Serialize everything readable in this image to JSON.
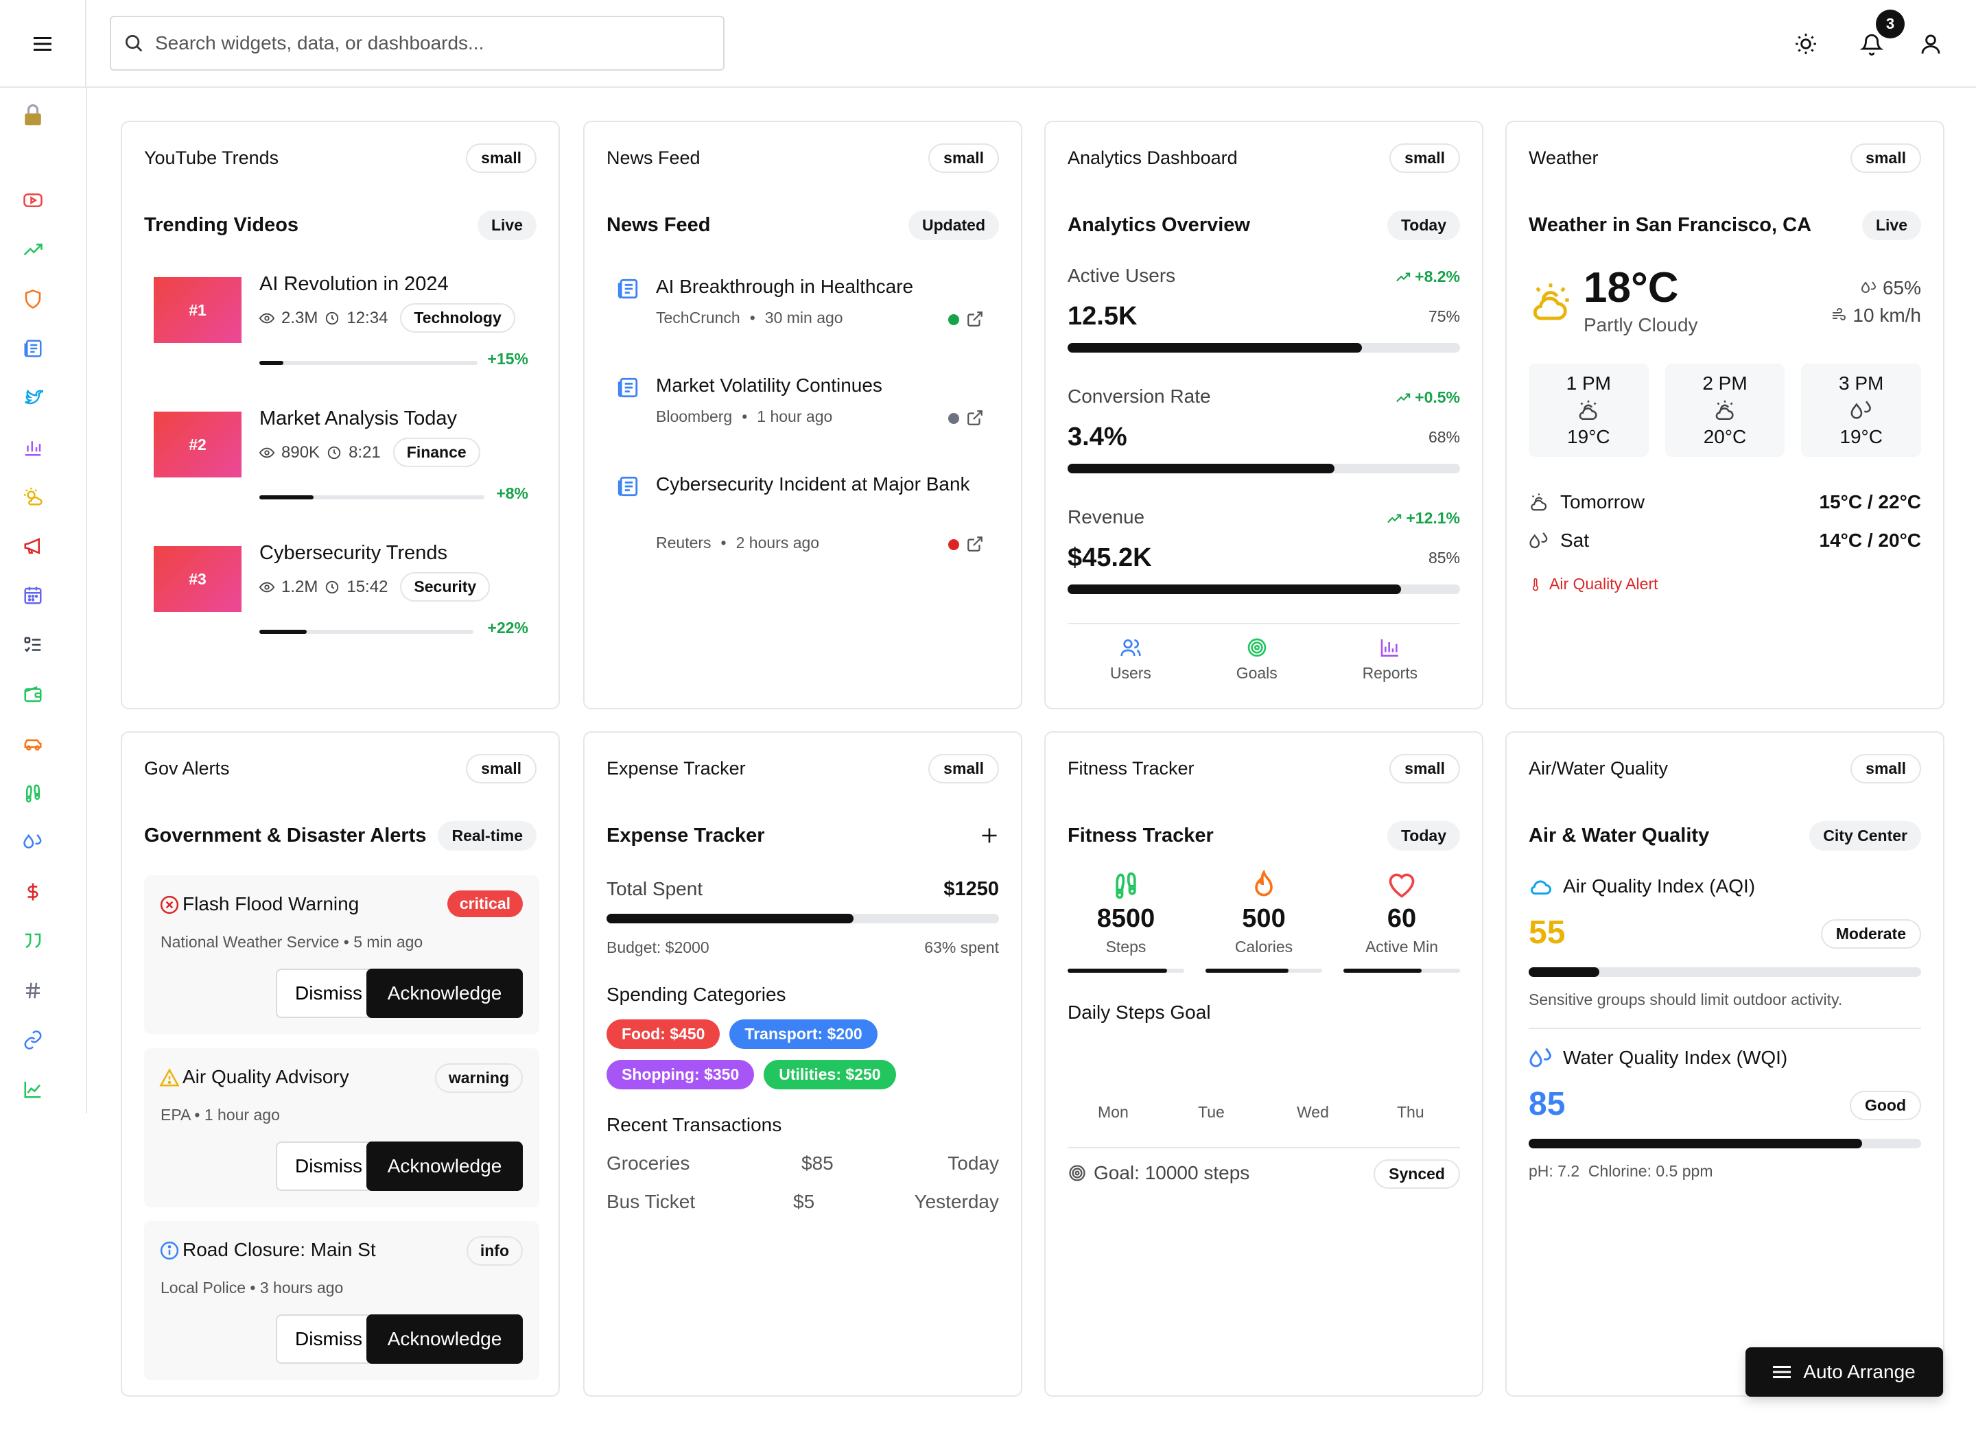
{
  "topbar": {
    "search_placeholder": "Search widgets, data, or dashboards...",
    "notification_count": "3"
  },
  "sidebar": {
    "icons": [
      "lock-icon",
      "youtube-icon",
      "trending-icon",
      "shield-icon",
      "news-icon",
      "twitter-icon",
      "bar-chart-icon",
      "sun-icon",
      "megaphone-icon",
      "calendar-icon",
      "list-icon",
      "wallet-icon",
      "car-icon",
      "footprints-icon",
      "droplet-icon",
      "dollar-icon",
      "quote-icon",
      "hash-icon",
      "link-icon",
      "line-chart-icon"
    ]
  },
  "youtube": {
    "title": "YouTube Trends",
    "size": "small",
    "subtitle": "Trending Videos",
    "status": "Live",
    "videos": [
      {
        "rank": "#1",
        "title": "AI Revolution in 2024",
        "views": "2.3M",
        "duration": "12:34",
        "tag": "Technology",
        "change": "+15%",
        "progress": 0.11
      },
      {
        "rank": "#2",
        "title": "Market Analysis Today",
        "views": "890K",
        "duration": "8:21",
        "tag": "Finance",
        "change": "+8%",
        "progress": 0.24
      },
      {
        "rank": "#3",
        "title": "Cybersecurity Trends",
        "views": "1.2M",
        "duration": "15:42",
        "tag": "Security",
        "change": "+22%",
        "progress": 0.22
      }
    ]
  },
  "news": {
    "title": "News Feed",
    "size": "small",
    "subtitle": "News Feed",
    "status": "Updated",
    "items": [
      {
        "title": "AI Breakthrough in Healthcare",
        "source": "TechCrunch",
        "time": "30 min ago",
        "dot": "#16a34a"
      },
      {
        "title": "Market Volatility Continues",
        "source": "Bloomberg",
        "time": "1 hour ago",
        "dot": "#6b7280"
      },
      {
        "title": "Cybersecurity Incident at Major Bank",
        "source": "Reuters",
        "time": "2 hours ago",
        "dot": "#dc2626"
      }
    ]
  },
  "analytics": {
    "title": "Analytics Dashboard",
    "size": "small",
    "subtitle": "Analytics Overview",
    "status": "Today",
    "metrics": [
      {
        "label": "Active Users",
        "change": "+8.2%",
        "value": "12.5K",
        "pct": "75%",
        "progress": 0.75
      },
      {
        "label": "Conversion Rate",
        "change": "+0.5%",
        "value": "3.4%",
        "pct": "68%",
        "progress": 0.68
      },
      {
        "label": "Revenue",
        "change": "+12.1%",
        "value": "$45.2K",
        "pct": "85%",
        "progress": 0.85
      }
    ],
    "nav": [
      "Users",
      "Goals",
      "Reports"
    ]
  },
  "weather": {
    "title": "Weather",
    "size": "small",
    "subtitle": "Weather in San Francisco, CA",
    "status": "Live",
    "temp": "18°C",
    "condition": "Partly Cloudy",
    "humidity": "65%",
    "wind": "10 km/h",
    "hourly": [
      {
        "time": "1 PM",
        "temp": "19°C"
      },
      {
        "time": "2 PM",
        "temp": "20°C"
      },
      {
        "time": "3 PM",
        "temp": "19°C"
      }
    ],
    "forecast": [
      {
        "day": "Tomorrow",
        "range": "15°C / 22°C"
      },
      {
        "day": "Sat",
        "range": "14°C / 20°C"
      }
    ],
    "alert": "Air Quality Alert"
  },
  "gov": {
    "title": "Gov Alerts",
    "size": "small",
    "subtitle": "Government & Disaster Alerts",
    "status": "Real-time",
    "dismiss_label": "Dismiss",
    "ack_label": "Acknowledge",
    "alerts": [
      {
        "title": "Flash Flood Warning",
        "level": "critical",
        "source": "National Weather Service • 5 min ago"
      },
      {
        "title": "Air Quality Advisory",
        "level": "warning",
        "source": "EPA • 1 hour ago"
      },
      {
        "title": "Road Closure: Main St",
        "level": "info",
        "source": "Local Police • 3 hours ago"
      }
    ]
  },
  "expense": {
    "title": "Expense Tracker",
    "size": "small",
    "subtitle": "Expense Tracker",
    "total_label": "Total Spent",
    "total": "$1250",
    "budget": "Budget: $2000",
    "spent_pct": "63% spent",
    "progress": 0.63,
    "categories_title": "Spending Categories",
    "categories": [
      {
        "label": "Food: $450",
        "color": "#ef4444"
      },
      {
        "label": "Transport: $200",
        "color": "#3b82f6"
      },
      {
        "label": "Shopping: $350",
        "color": "#a855f7"
      },
      {
        "label": "Utilities: $250",
        "color": "#22c55e"
      }
    ],
    "transactions_title": "Recent Transactions",
    "transactions": [
      {
        "name": "Groceries",
        "amount": "$85",
        "date": "Today"
      },
      {
        "name": "Bus Ticket",
        "amount": "$5",
        "date": "Yesterday"
      }
    ]
  },
  "fitness": {
    "title": "Fitness Tracker",
    "size": "small",
    "subtitle": "Fitness Tracker",
    "status": "Today",
    "stats": [
      {
        "value": "8500",
        "label": "Steps",
        "progress": 0.85,
        "color": "#22c55e"
      },
      {
        "value": "500",
        "label": "Calories",
        "progress": 0.71,
        "color": "#f97316"
      },
      {
        "value": "60",
        "label": "Active Min",
        "progress": 0.67,
        "color": "#ef4444"
      }
    ],
    "goal_title": "Daily Steps Goal",
    "days": [
      "Mon",
      "Tue",
      "Wed",
      "Thu"
    ],
    "goal": "Goal: 10000 steps",
    "sync": "Synced"
  },
  "airwater": {
    "title": "Air/Water Quality",
    "size": "small",
    "subtitle": "Air & Water Quality",
    "location": "City Center",
    "aqi_label": "Air Quality Index (AQI)",
    "aqi_value": "55",
    "aqi_status": "Moderate",
    "aqi_progress": 0.18,
    "aqi_note": "Sensitive groups should limit outdoor activity.",
    "wqi_label": "Water Quality Index (WQI)",
    "wqi_value": "85",
    "wqi_status": "Good",
    "wqi_progress": 0.85,
    "wqi_note": "pH: 7.2  Chlorine: 0.5 ppm"
  },
  "auto_arrange": "Auto Arrange"
}
